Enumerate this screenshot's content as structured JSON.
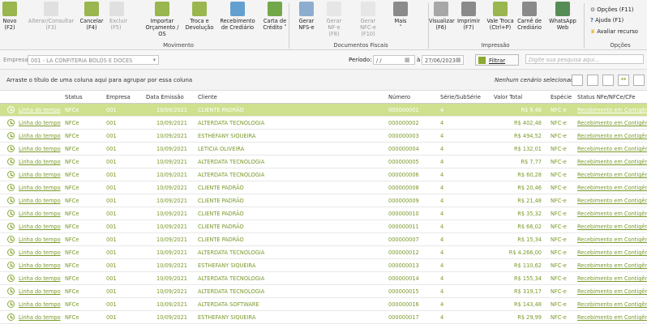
{
  "ribbon": {
    "buttons": [
      {
        "l1": "Novo",
        "l2": "(F2)",
        "dis": false
      },
      {
        "l1": "Alterar/Consultar",
        "l2": "(F3)",
        "dis": true
      },
      {
        "l1": "Cancelar",
        "l2": "(F4)",
        "dis": false
      },
      {
        "l1": "Excluir",
        "l2": "(F5)",
        "dis": true
      },
      {
        "l1": "Importar",
        "l2": "Orçamento / OS",
        "dis": false
      },
      {
        "l1": "Troca e",
        "l2": "Devolução",
        "dis": false
      },
      {
        "l1": "Recebimento",
        "l2": "de Crediário",
        "dis": false
      },
      {
        "l1": "Carta de",
        "l2": "Crédito ˅",
        "dis": false
      },
      {
        "l1": "Gerar",
        "l2": "NFS-e",
        "dis": false
      },
      {
        "l1": "Gerar",
        "l2": "NF-e (F8)",
        "dis": true
      },
      {
        "l1": "Gerar",
        "l2": "NFC-e (F10)",
        "dis": true
      },
      {
        "l1": "Mais",
        "l2": "˅",
        "dis": false
      },
      {
        "l1": "Visualizar",
        "l2": "(F6)",
        "dis": false
      },
      {
        "l1": "Imprimir",
        "l2": "(F7)",
        "dis": false
      },
      {
        "l1": "Vale Troca",
        "l2": "(Ctrl+P)",
        "dis": false
      },
      {
        "l1": "Carnê de",
        "l2": "Crediário",
        "dis": false
      },
      {
        "l1": "WhatsApp",
        "l2": "Web",
        "dis": false
      }
    ],
    "groups": {
      "movimento": "Movimento",
      "fiscais": "Documentos Fiscais",
      "impressao": "Impressão",
      "opcoes": "Opções"
    },
    "options": {
      "opcoes": "Opções (F11)",
      "ajuda": "Ajuda (F1)",
      "avaliar": "Avaliar recurso"
    }
  },
  "filter": {
    "empresa_label": "Empresa:",
    "empresa_value": "001 - LA CONFITERIA BOLOS E DOCES",
    "periodo_label": "Período:",
    "date_from": " / /",
    "date_sep": "à",
    "date_to": "27/06/2023",
    "filtrar": "Filtrar",
    "search_placeholder": "Digite sua pesquisa aqui..."
  },
  "group_hint": "Arraste o título de uma coluna aqui para agrupar por essa coluna",
  "scenario": "Nenhum cenário selecionado.",
  "columns": [
    "Status",
    "Empresa",
    "Data Emissão",
    "Cliente",
    "Número",
    "Série/SubSérie",
    "Valor Total",
    "Espécie",
    "Status NFe/NFCe/CFe"
  ],
  "rows": [
    [
      "Linha do tempo",
      "NFCe",
      "001",
      "10/09/2021",
      "CLIENTE PADRÃO",
      "000000001",
      "4",
      "R$ 9,48",
      "NFC-e",
      "Recebimento em Contigên"
    ],
    [
      "Linha do tempo",
      "NFCe",
      "001",
      "10/09/2021",
      "ALTERDATA TECNOLOGIA",
      "000000002",
      "4",
      "R$ 402,48",
      "NFC-e",
      "Recebimento em Contigên"
    ],
    [
      "Linha do tempo",
      "NFCe",
      "001",
      "10/09/2021",
      "ESTHEFANY SIQUEIRA",
      "000000003",
      "4",
      "R$ 494,52",
      "NFC-e",
      "Recebimento em Contigên"
    ],
    [
      "Linha do tempo",
      "NFCe",
      "001",
      "10/09/2021",
      "LETICIA OLIVEIRA",
      "000000004",
      "4",
      "R$ 132,01",
      "NFC-e",
      "Recebimento em Contigên"
    ],
    [
      "Linha do tempo",
      "NFCe",
      "001",
      "10/09/2021",
      "ALTERDATA TECNOLOGIA",
      "000000005",
      "4",
      "R$ 7,77",
      "NFC-e",
      "Recebimento em Contigên"
    ],
    [
      "Linha do tempo",
      "NFCe",
      "001",
      "10/09/2021",
      "ALTERDATA TECNOLOGIA",
      "000000006",
      "4",
      "R$ 60,28",
      "NFC-e",
      "Recebimento em Contigên"
    ],
    [
      "Linha do tempo",
      "NFCe",
      "001",
      "10/09/2021",
      "CLIENTE PADRÃO",
      "000000008",
      "4",
      "R$ 20,46",
      "NFC-e",
      "Recebimento em Contigên"
    ],
    [
      "Linha do tempo",
      "NFCe",
      "001",
      "10/09/2021",
      "CLIENTE PADRÃO",
      "000000009",
      "4",
      "R$ 21,48",
      "NFC-e",
      "Recebimento em Contigên"
    ],
    [
      "Linha do tempo",
      "NFCe",
      "001",
      "10/09/2021",
      "CLIENTE PADRÃO",
      "000000010",
      "4",
      "R$ 35,32",
      "NFC-e",
      "Recebimento em Contigên"
    ],
    [
      "Linha do tempo",
      "NFCe",
      "001",
      "10/09/2021",
      "CLIENTE PADRÃO",
      "000000011",
      "4",
      "R$ 66,02",
      "NFC-e",
      "Recebimento em Contigên"
    ],
    [
      "Linha do tempo",
      "NFCe",
      "001",
      "10/09/2021",
      "CLIENTE PADRÃO",
      "000000007",
      "4",
      "R$ 15,34",
      "NFC-e",
      "Recebimento em Contigên"
    ],
    [
      "Linha do tempo",
      "NFCe",
      "001",
      "10/09/2021",
      "ALTERDATA TECNOLOGIA",
      "000000012",
      "4",
      "R$ 4.266,00",
      "NFC-e",
      "Recebimento em Contigên"
    ],
    [
      "Linha do tempo",
      "NFCe",
      "001",
      "10/09/2021",
      "ESTHEFANY SIQUEIRA",
      "000000013",
      "4",
      "R$ 110,62",
      "NFC-e",
      "Recebimento em Contigên"
    ],
    [
      "Linha do tempo",
      "NFCe",
      "001",
      "10/09/2021",
      "ALTERDATA TECNOLOGIA",
      "000000014",
      "4",
      "R$ 155,34",
      "NFC-e",
      "Recebimento em Contigên"
    ],
    [
      "Linha do tempo",
      "NFCe",
      "001",
      "10/09/2021",
      "ALTERDATA TECNOLOGIA",
      "000000015",
      "4",
      "R$ 319,17",
      "NFC-e",
      "Recebimento em Contigên"
    ],
    [
      "Linha do tempo",
      "NFCe",
      "001",
      "10/09/2021",
      "ALTERDATA SOFTWARE",
      "000000016",
      "4",
      "R$ 143,48",
      "NFC-e",
      "Recebimento em Contigên"
    ],
    [
      "Linha do tempo",
      "NFCe",
      "001",
      "10/09/2021",
      "ESTHEFANY SIQUEIRA",
      "000000017",
      "4",
      "R$ 29,99",
      "NFC-e",
      "Recebimento em Contigên"
    ]
  ],
  "colors": {
    "accent": "#8aaa30",
    "selected_row": "#cfe08f",
    "link": "#7a9a2a"
  }
}
